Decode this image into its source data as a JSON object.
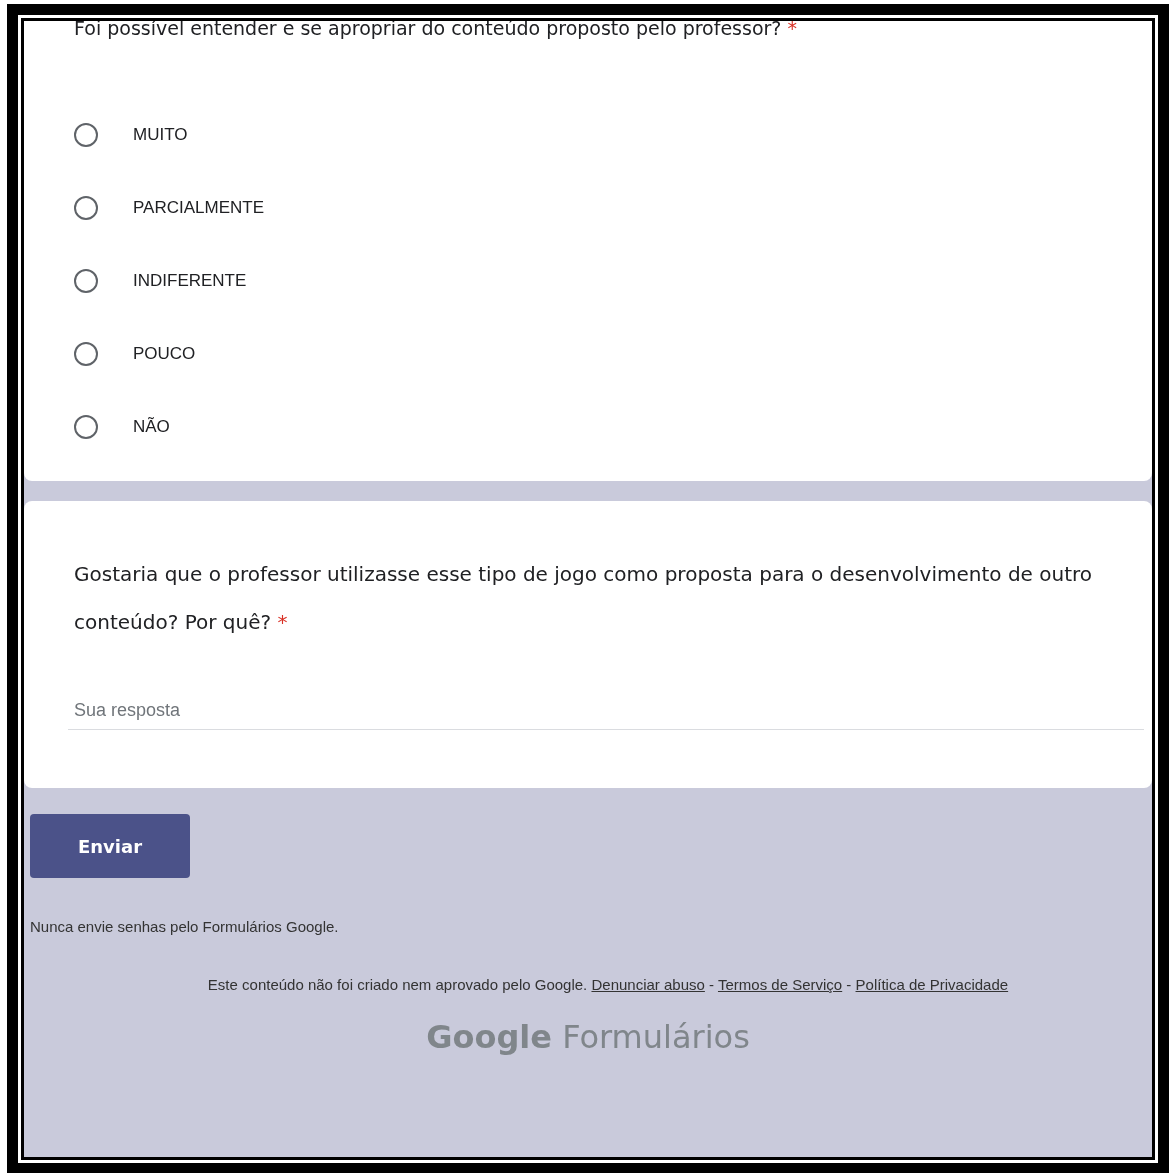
{
  "questions": [
    {
      "kind": "choice",
      "title": "Foi possível entender e se apropriar do conteúdo proposto pelo professor?",
      "required_mark": "*",
      "options": [
        {
          "label": "MUITO",
          "selected": false
        },
        {
          "label": "PARCIALMENTE",
          "selected": false
        },
        {
          "label": "INDIFERENTE",
          "selected": false
        },
        {
          "label": "POUCO",
          "selected": false
        },
        {
          "label": "NÃO",
          "selected": false
        }
      ]
    },
    {
      "kind": "text",
      "title": "Gostaria que o professor utilizasse esse tipo de jogo como proposta para o desenvolvimento de outro conteúdo? Por quê?",
      "required_mark": "*",
      "placeholder": "Sua resposta"
    }
  ],
  "submit_button": "Enviar",
  "password_warning": "Nunca envie senhas pelo Formulários Google.",
  "footer": {
    "disclaimer": "Este conteúdo não foi criado nem aprovado pelo Google.",
    "links": [
      "Denunciar abuso",
      "Termos de Serviço",
      "Política de Privacidade"
    ],
    "separator": "-"
  },
  "logo": {
    "brand": "Google",
    "product": "Formulários"
  }
}
